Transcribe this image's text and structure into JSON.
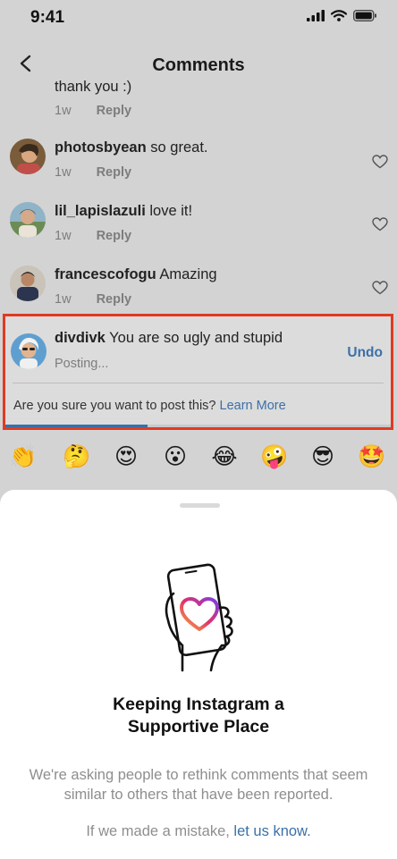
{
  "status_bar": {
    "time": "9:41"
  },
  "nav": {
    "title": "Comments"
  },
  "comments": [
    {
      "username": "",
      "text": "thank you :)",
      "age": "1w",
      "reply": "Reply"
    },
    {
      "username": "photosbyean",
      "text": "so great.",
      "age": "1w",
      "reply": "Reply"
    },
    {
      "username": "lil_lapislazuli",
      "text": "love it!",
      "age": "1w",
      "reply": "Reply"
    },
    {
      "username": "francescofogu",
      "text": "Amazing",
      "age": "1w",
      "reply": "Reply"
    }
  ],
  "pending_comment": {
    "username": "divdivk",
    "text": "You are so ugly and stupid",
    "status": "Posting...",
    "undo": "Undo",
    "confirm_prompt": "Are you sure you want to post this?",
    "learn_more": "Learn More",
    "progress": 0.37
  },
  "emoji_bar": [
    "👏",
    "🤔",
    "😍",
    "😮",
    "😂",
    "🤪",
    "😎",
    "🤩"
  ],
  "sheet": {
    "title_line1": "Keeping Instagram a",
    "title_line2": "Supportive Place",
    "body": "We're asking people to rethink comments that seem similar to others that have been reported.",
    "footer_text": "If we made a mistake,",
    "footer_link": "let us know",
    "footer_end": "."
  },
  "colors": {
    "accent_link": "#3b70a8",
    "highlight_border": "#e03a23",
    "heart_gradient": [
      "#f7b13b",
      "#e1306c",
      "#7a3fe4"
    ]
  }
}
